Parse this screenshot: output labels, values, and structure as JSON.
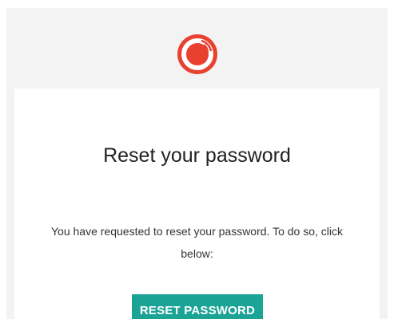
{
  "brand": {
    "logo": "sencha-logo-icon",
    "color": "#e8412f"
  },
  "content": {
    "title": "Reset your password",
    "message": "You have requested to reset your password. To do so, click below:",
    "button_label": "RESET PASSWORD",
    "button_color": "#1ba396"
  },
  "colors": {
    "background": "#f3f3f3",
    "card": "#ffffff",
    "text": "#222222"
  }
}
